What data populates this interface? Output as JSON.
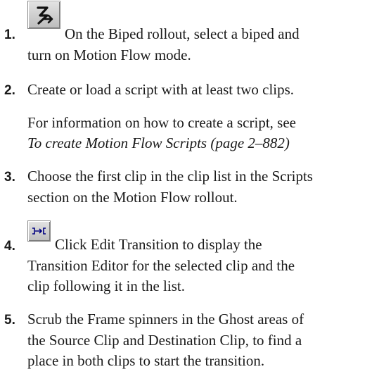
{
  "steps": [
    {
      "number": "1.",
      "icon": "biped-motion-flow-icon",
      "lines": [
        "On the Biped rollout, select a biped and",
        "turn on Motion Flow mode."
      ]
    },
    {
      "number": "2.",
      "lines": [
        "Create or load a script with at least two clips."
      ],
      "note_line1": "For information on how to create a script, see",
      "note_link": "To create Motion Flow Scripts (page 2–882)"
    },
    {
      "number": "3.",
      "lines": [
        "Choose the first clip in the clip list in the Scripts",
        "section on the Motion Flow rollout."
      ]
    },
    {
      "number": "4.",
      "icon": "edit-transition-icon",
      "lines": [
        "Click Edit Transition to display the",
        "Transition Editor for the selected clip and the",
        "clip following it in the list."
      ]
    },
    {
      "number": "5.",
      "lines": [
        "Scrub the Frame spinners in the Ghost areas of",
        "the Source Clip and Destination Clip, to find a",
        "place in both clips to start the transition."
      ]
    }
  ]
}
